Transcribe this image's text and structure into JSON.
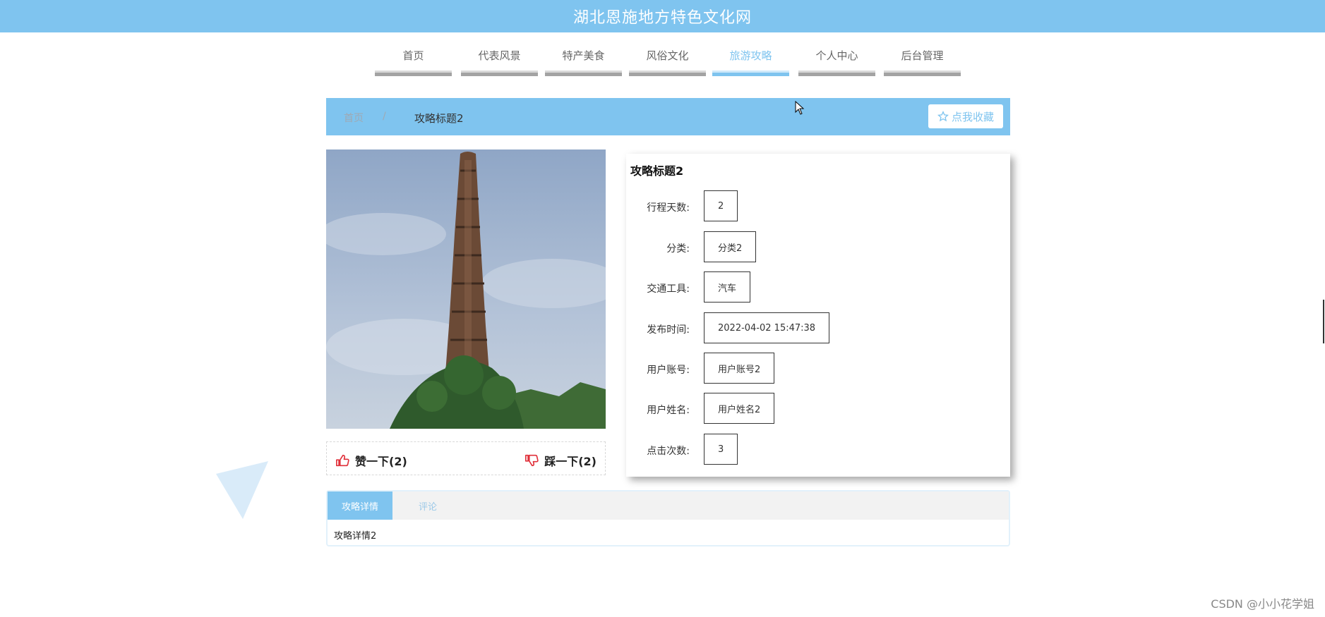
{
  "header": {
    "title": "湖北恩施地方特色文化网"
  },
  "nav": {
    "items": [
      {
        "label": "首页"
      },
      {
        "label": "代表风景"
      },
      {
        "label": "特产美食"
      },
      {
        "label": "风俗文化"
      },
      {
        "label": "旅游攻略"
      },
      {
        "label": "个人中心"
      },
      {
        "label": "后台管理"
      }
    ],
    "active": "旅游攻略"
  },
  "breadcrumb": {
    "home": "首页",
    "separator": "/",
    "current": "攻略标题2"
  },
  "favorite_button": {
    "label": "点我收藏",
    "icon": "star-icon"
  },
  "detail": {
    "title": "攻略标题2",
    "fields": [
      {
        "label": "行程天数:",
        "value": "2"
      },
      {
        "label": "分类:",
        "value": "分类2"
      },
      {
        "label": "交通工具:",
        "value": "汽车"
      },
      {
        "label": "发布时间:",
        "value": "2022-04-02 15:47:38"
      },
      {
        "label": "用户账号:",
        "value": "用户账号2"
      },
      {
        "label": "用户姓名:",
        "value": "用户姓名2"
      },
      {
        "label": "点击次数:",
        "value": "3"
      }
    ]
  },
  "reactions": {
    "like_label": "赞一下(2)",
    "dislike_label": "踩一下(2)"
  },
  "tabs": {
    "items": [
      {
        "label": "攻略详情"
      },
      {
        "label": "评论"
      }
    ],
    "active": "攻略详情",
    "content": "攻略详情2"
  },
  "watermark": "CSDN @小小花学姐",
  "colors": {
    "accent": "#7fc4ef",
    "like": "#e0303a"
  }
}
